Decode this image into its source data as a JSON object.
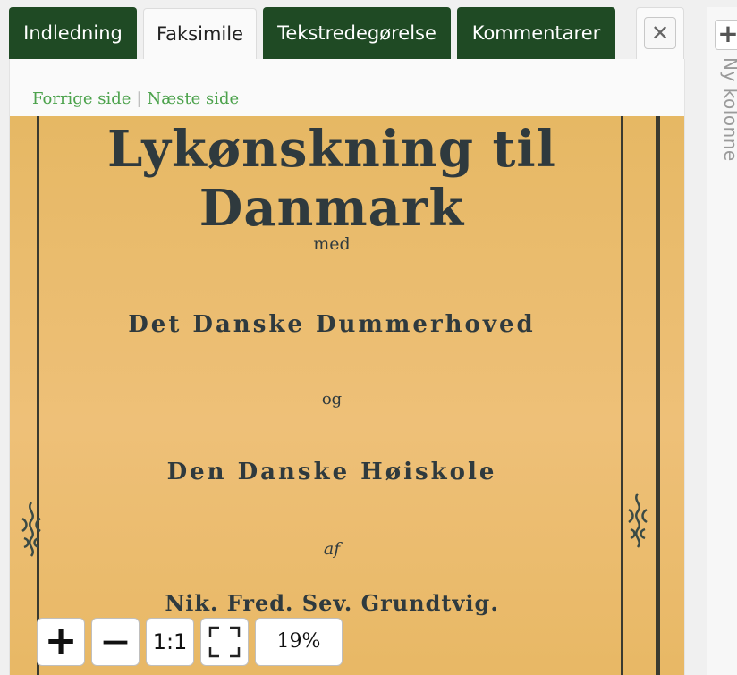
{
  "tabs": [
    {
      "label": "Indledning",
      "active": false
    },
    {
      "label": "Faksimile",
      "active": true
    },
    {
      "label": "Tekstredegørelse",
      "active": false
    },
    {
      "label": "Kommentarer",
      "active": false
    }
  ],
  "close_icon": "close-icon",
  "pager": {
    "prev": "Forrige side",
    "separator": "|",
    "next": "Næste side"
  },
  "facsimile": {
    "title": "Lykønskning til Danmark",
    "line1": "med",
    "line2": "Det Danske Dummerhoved",
    "line3": "og",
    "line4": "Den Danske Høiskole",
    "line5": "af",
    "author": "Nik. Fred. Sev. Grundtvig."
  },
  "zoom": {
    "zoom_in": "+",
    "zoom_out": "—",
    "actual_size": "1:1",
    "fit_icon": "fit-screen-icon",
    "level": "19%"
  },
  "new_column": {
    "icon": "plus-icon",
    "label": "Ny kolonne"
  },
  "colors": {
    "tab_bg": "#1f4a24",
    "link": "#4ca24c",
    "paper": "#e9bd66",
    "ink": "#2f3a3e"
  }
}
